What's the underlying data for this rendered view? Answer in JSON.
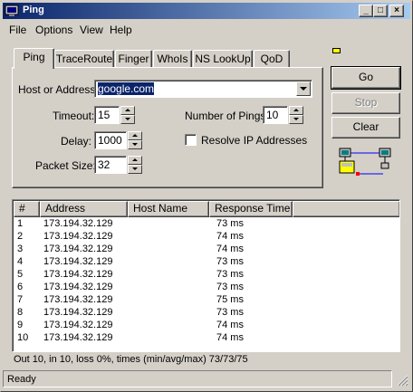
{
  "window": {
    "title": "Ping",
    "buttons": {
      "minimize": "_",
      "maximize": "□",
      "close": "×"
    }
  },
  "menu": [
    "File",
    "Options",
    "View",
    "Help"
  ],
  "tabs": [
    "Ping",
    "TraceRoute",
    "Finger",
    "WhoIs",
    "NS LookUp",
    "QoD"
  ],
  "form": {
    "host_label": "Host or Address:",
    "host_value": "google.com",
    "timeout_label": "Timeout:",
    "timeout_value": "15",
    "delay_label": "Delay:",
    "delay_value": "1000",
    "packet_label": "Packet Size:",
    "packet_value": "32",
    "num_pings_label": "Number of Pings:",
    "num_pings_value": "10",
    "resolve_label": "Resolve IP Addresses"
  },
  "actions": {
    "go": "Go",
    "stop": "Stop",
    "clear": "Clear"
  },
  "table": {
    "columns": [
      "#",
      "Address",
      "Host Name",
      "Response Time"
    ],
    "rows": [
      [
        "1",
        "173.194.32.129",
        "",
        "73 ms"
      ],
      [
        "2",
        "173.194.32.129",
        "",
        "74 ms"
      ],
      [
        "3",
        "173.194.32.129",
        "",
        "74 ms"
      ],
      [
        "4",
        "173.194.32.129",
        "",
        "73 ms"
      ],
      [
        "5",
        "173.194.32.129",
        "",
        "73 ms"
      ],
      [
        "6",
        "173.194.32.129",
        "",
        "73 ms"
      ],
      [
        "7",
        "173.194.32.129",
        "",
        "75 ms"
      ],
      [
        "8",
        "173.194.32.129",
        "",
        "73 ms"
      ],
      [
        "9",
        "173.194.32.129",
        "",
        "74 ms"
      ],
      [
        "10",
        "173.194.32.129",
        "",
        "74 ms"
      ]
    ]
  },
  "summary": "Out 10, in 10, loss 0%, times (min/avg/max) 73/73/75",
  "status": "Ready",
  "colors": {
    "title_start": "#0a246a",
    "title_end": "#a6caf0",
    "face": "#d4d0c8",
    "selection": "#0a246a",
    "indicator": "#ffff00"
  }
}
